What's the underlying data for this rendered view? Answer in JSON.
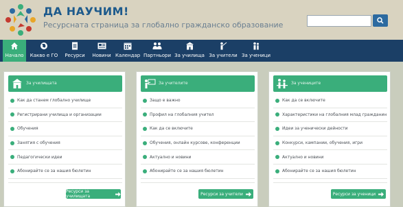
{
  "header": {
    "title": "ДА НАУЧИМ!",
    "subtitle": "Ресурсната страница за глобално гражданско образование",
    "search": {
      "value": "",
      "placeholder": "",
      "icon": "search-icon"
    },
    "logo_icon": "people-circle-logo"
  },
  "nav": {
    "active_color": "#3aae7b",
    "bar_color": "#1b3f66",
    "items": [
      {
        "label": "Начало",
        "icon": "home-icon",
        "active": true
      },
      {
        "label": "Какво е ГО",
        "icon": "globe-icon"
      },
      {
        "label": "Ресурси",
        "icon": "document-icon"
      },
      {
        "label": "Новини",
        "icon": "newspaper-icon"
      },
      {
        "label": "Календар",
        "icon": "calendar-icon"
      },
      {
        "label": "Партньори",
        "icon": "people-icon"
      },
      {
        "label": "За училища",
        "icon": "school-icon"
      },
      {
        "label": "За учители",
        "icon": "teacher-icon"
      },
      {
        "label": "За ученици",
        "icon": "students-icon"
      }
    ]
  },
  "panels": [
    {
      "title": "За училищата",
      "icon": "school-icon",
      "items": [
        "Как да станем глобално училище",
        "Регистрирани училища и организации",
        "Обучения",
        "Занятия с обучения",
        "Педагогически идеи",
        "Абонирайте се за нашия бюлетин"
      ],
      "button": "Ресурси за училищата"
    },
    {
      "title": "За учителите",
      "icon": "teacher-icon",
      "items": [
        "Защо е важно",
        "Профил на глобалния учител",
        "Как да се включите",
        "Обучения, онлайн курсове, конференции",
        "Актуално и новини",
        "Абонирайте се за нашия бюлетин"
      ],
      "button": "Ресурси за учители"
    },
    {
      "title": "За учениците",
      "icon": "students-icon",
      "items": [
        "Как да се включите",
        "Характеристики на глобалния млад гражданин",
        "Идеи за ученически дейности",
        "Конкурси, кампании, обучения, игри",
        "Актуално и новини",
        "Абонирайте се за нашия бюлетин"
      ],
      "button": "Ресурси за ученици"
    }
  ]
}
